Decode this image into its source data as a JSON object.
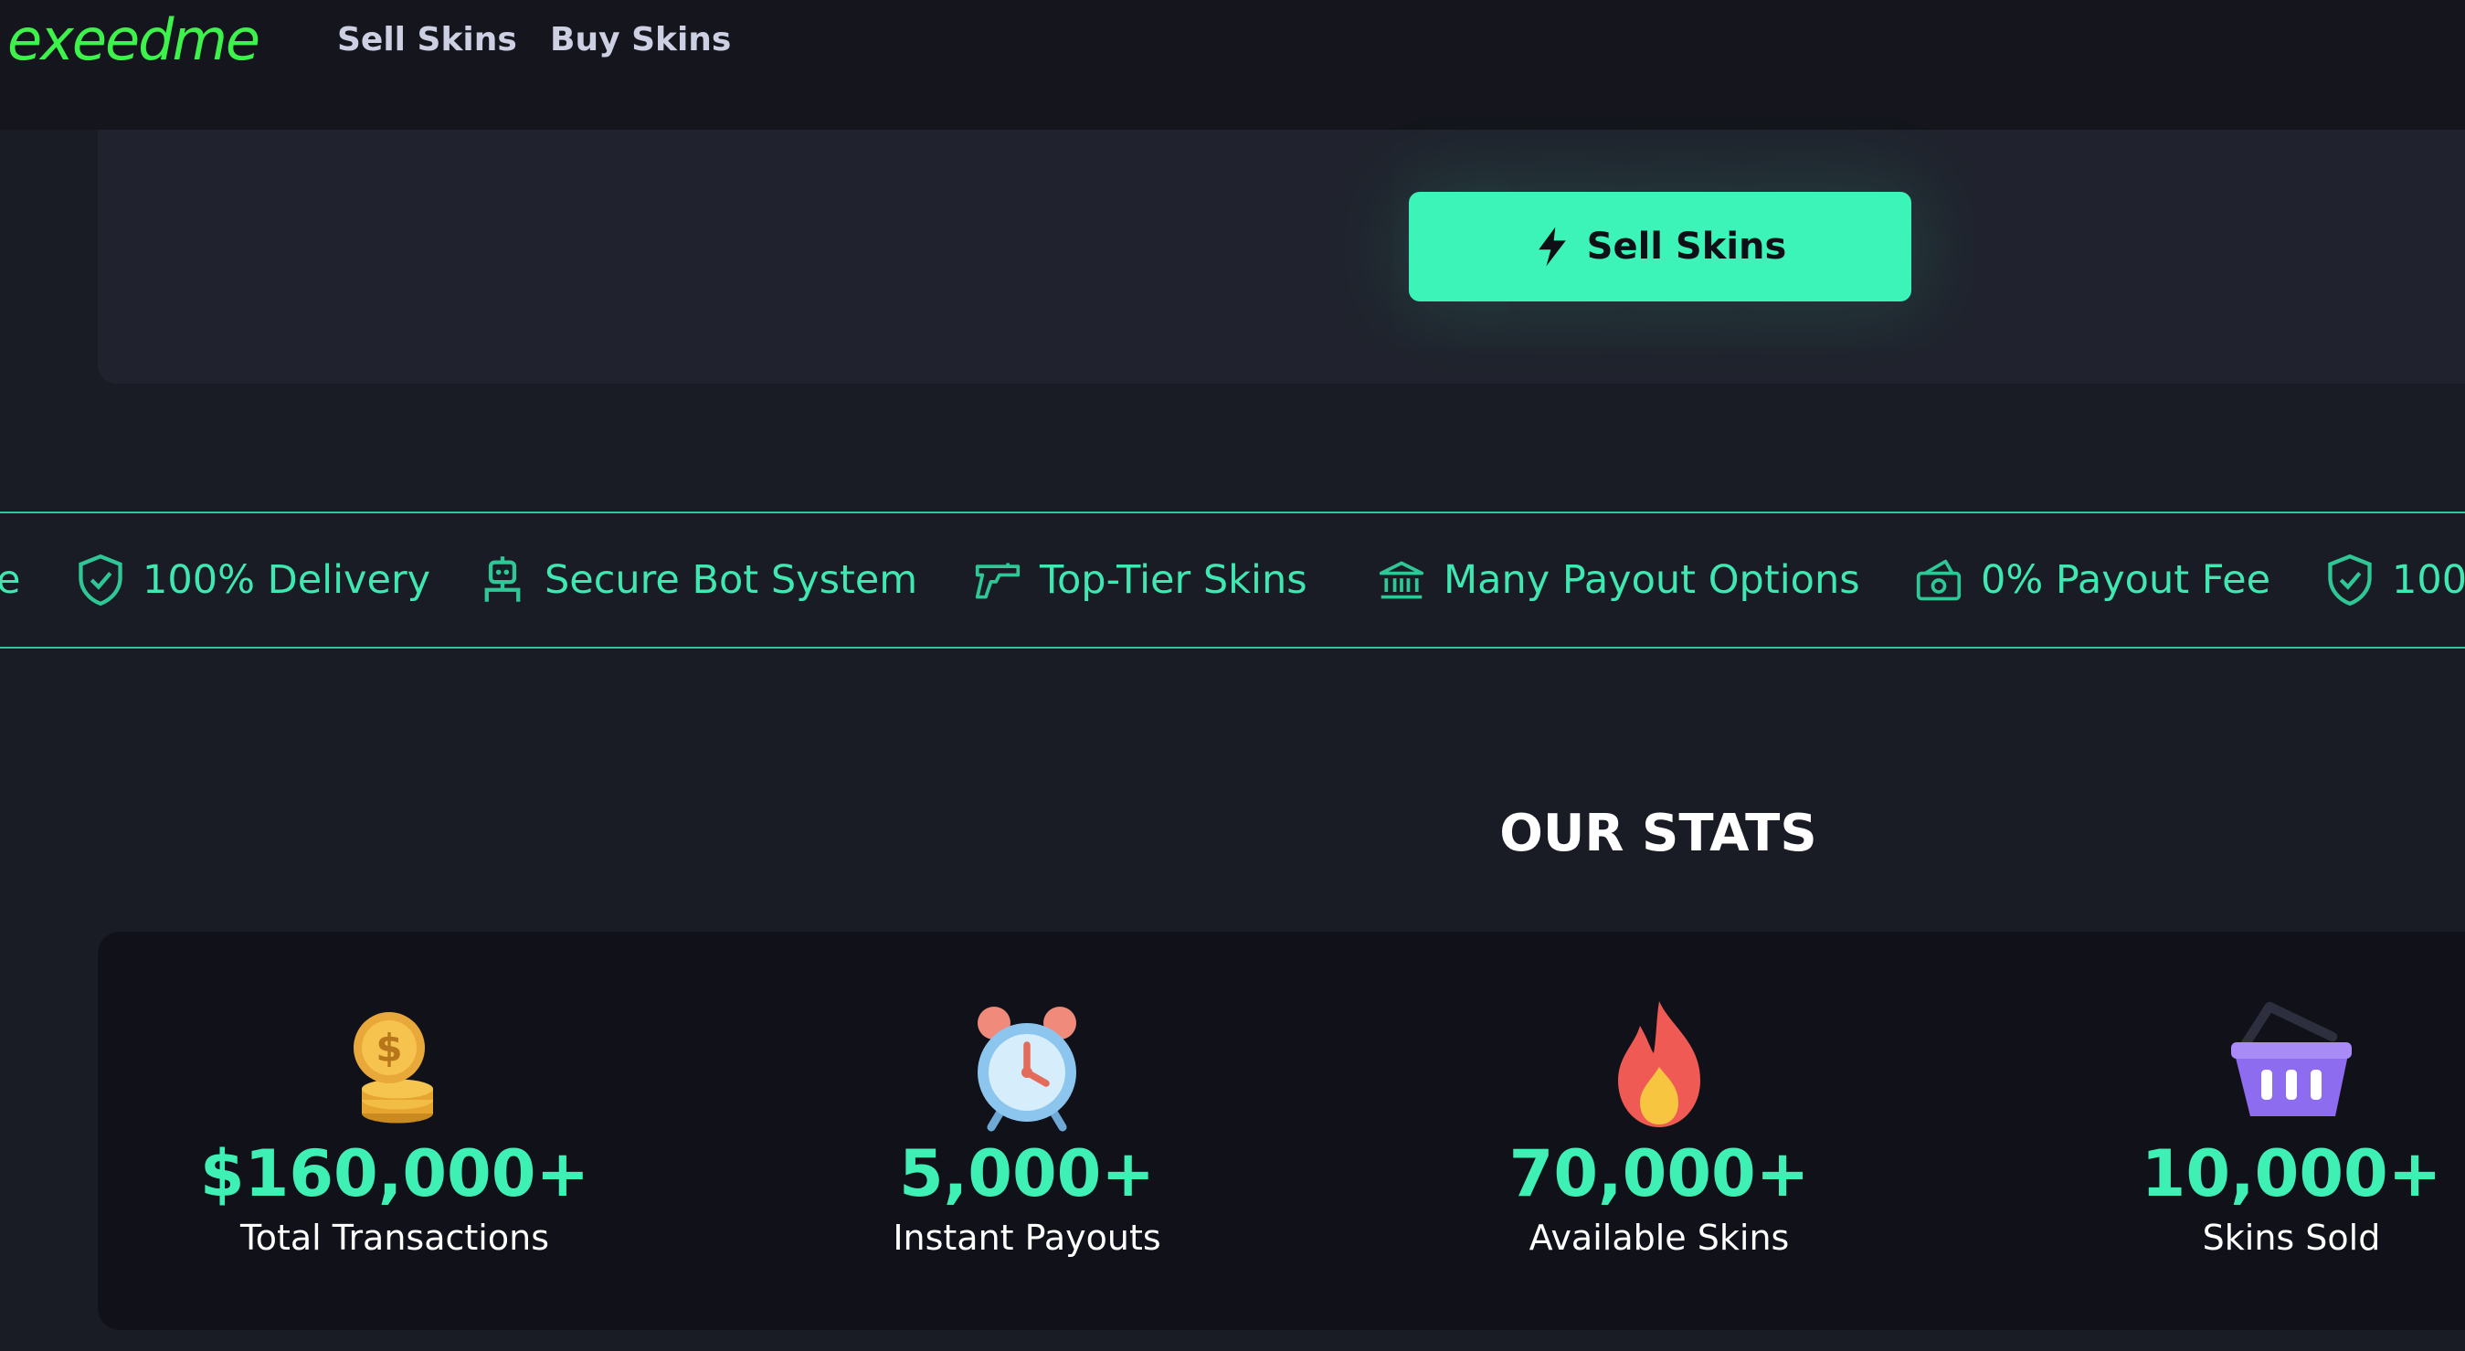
{
  "header": {
    "logo": "exeedme",
    "nav": [
      "Sell Skins",
      "Buy Skins"
    ]
  },
  "hero": {
    "sell_button": "Sell Skins"
  },
  "features_strip": [
    {
      "label": "e",
      "icon": "partial-text"
    },
    {
      "label": "100% Delivery",
      "icon": "shield-check-icon"
    },
    {
      "label": "Secure Bot System",
      "icon": "robot-icon"
    },
    {
      "label": "Top-Tier Skins",
      "icon": "pistol-icon"
    },
    {
      "label": "Many Payout Options",
      "icon": "bank-icon"
    },
    {
      "label": "0% Payout Fee",
      "icon": "cash-icon"
    },
    {
      "label": "100",
      "icon": "shield-check-icon"
    }
  ],
  "stats": {
    "title": "OUR STATS",
    "items": [
      {
        "value": "$160,000+",
        "label": "Total Transactions",
        "icon": "coins-icon"
      },
      {
        "value": "5,000+",
        "label": "Instant Payouts",
        "icon": "alarm-clock-icon"
      },
      {
        "value": "70,000+",
        "label": "Available Skins",
        "icon": "fire-icon"
      },
      {
        "value": "10,000+",
        "label": "Skins Sold",
        "icon": "basket-icon"
      }
    ]
  },
  "colors": {
    "accent": "#3cf4b7",
    "logo": "#3cf24b",
    "background": "#1a1c25",
    "header": "#14151d"
  }
}
